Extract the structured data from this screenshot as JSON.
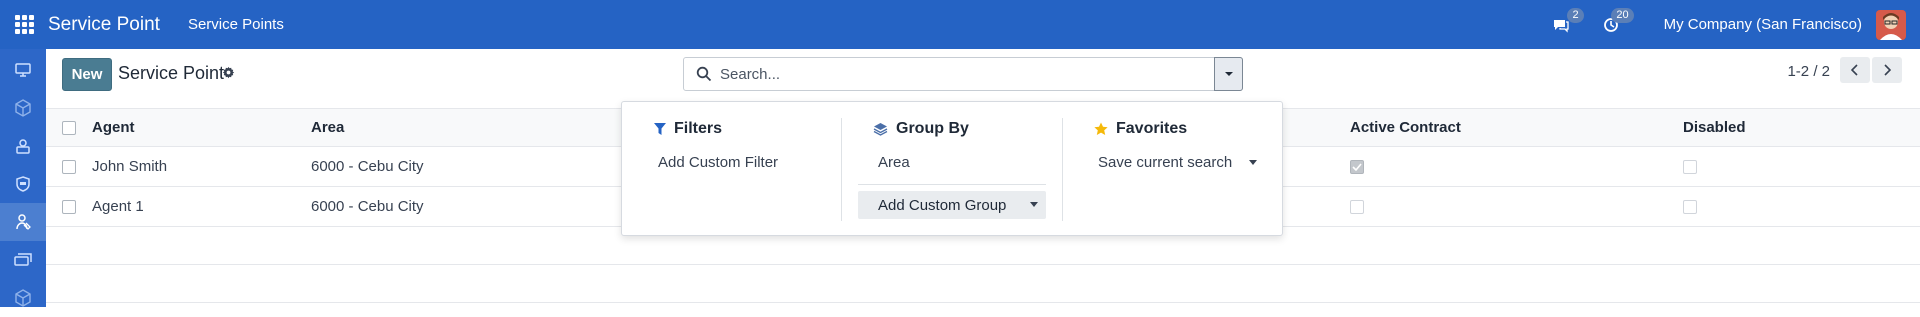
{
  "navbar": {
    "brand": "Service Point",
    "menu": "Service Points",
    "messages_count": "2",
    "activities_count": "20",
    "company": "My Company (San Francisco)"
  },
  "rail": {
    "icons": [
      "monitor-icon",
      "cube-icon",
      "user-card-icon",
      "id-badge-icon",
      "service-point-icon",
      "cards-icon",
      "box-icon"
    ]
  },
  "control_panel": {
    "new_label": "New",
    "breadcrumb": "Service Point",
    "search_placeholder": "Search...",
    "pager": "1-2 / 2"
  },
  "table": {
    "columns": [
      "Agent",
      "Area",
      "Active Contract",
      "Disabled"
    ],
    "rows": [
      {
        "agent": "John Smith",
        "area": "6000 - Cebu City",
        "active_contract": true,
        "disabled": false
      },
      {
        "agent": "Agent 1",
        "area": "6000 - Cebu City",
        "active_contract": false,
        "disabled": false
      }
    ]
  },
  "panel": {
    "filters": {
      "title": "Filters",
      "add_custom_filter": "Add Custom Filter"
    },
    "group_by": {
      "title": "Group By",
      "option": "Area",
      "add_custom_group": "Add Custom Group"
    },
    "favorites": {
      "title": "Favorites",
      "save_current_search": "Save current search"
    }
  },
  "colors": {
    "navbar": "#2563c4",
    "primary_button": "#4a7c92",
    "rail": "#2d67c8"
  }
}
